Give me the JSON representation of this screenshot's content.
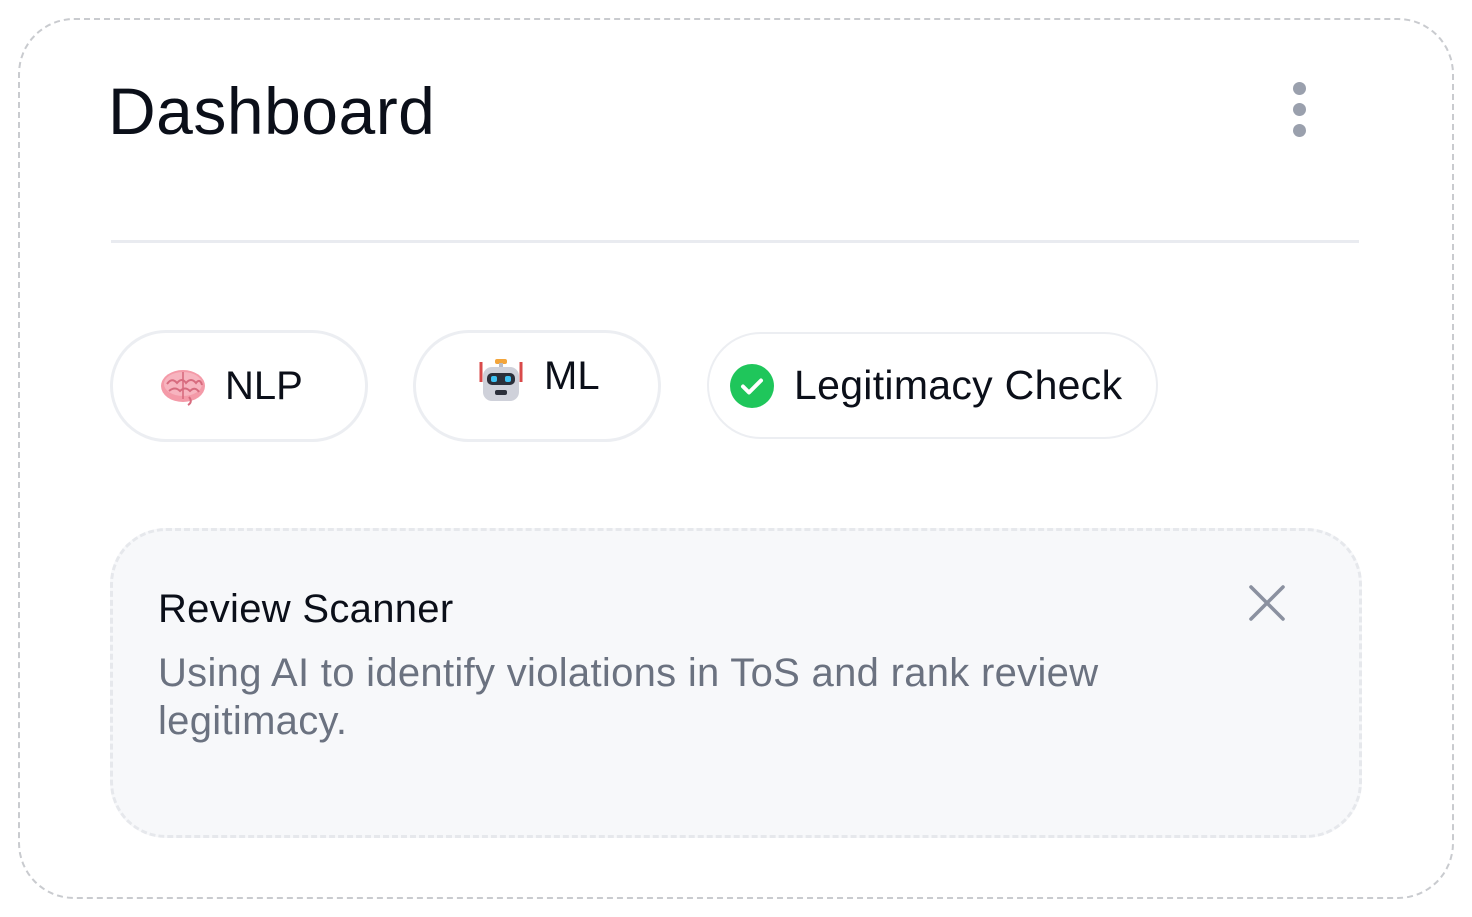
{
  "header": {
    "title": "Dashboard",
    "menu_icon": "more-vertical-icon"
  },
  "tags": [
    {
      "label": "NLP",
      "icon": "brain-icon"
    },
    {
      "label": "ML",
      "icon": "robot-icon"
    },
    {
      "label": "Legitimacy Check",
      "icon": "check-circle-icon"
    }
  ],
  "card": {
    "title": "Review Scanner",
    "description": "Using AI to identify violations in ToS and rank review legitimacy.",
    "close_icon": "close-icon"
  },
  "colors": {
    "title_text": "#0b0f19",
    "muted_text": "#6b7280",
    "icon_gray": "#9aa0ad",
    "success_green": "#1fc65b",
    "card_background": "#f7f8fa",
    "border": "#eceef2"
  }
}
